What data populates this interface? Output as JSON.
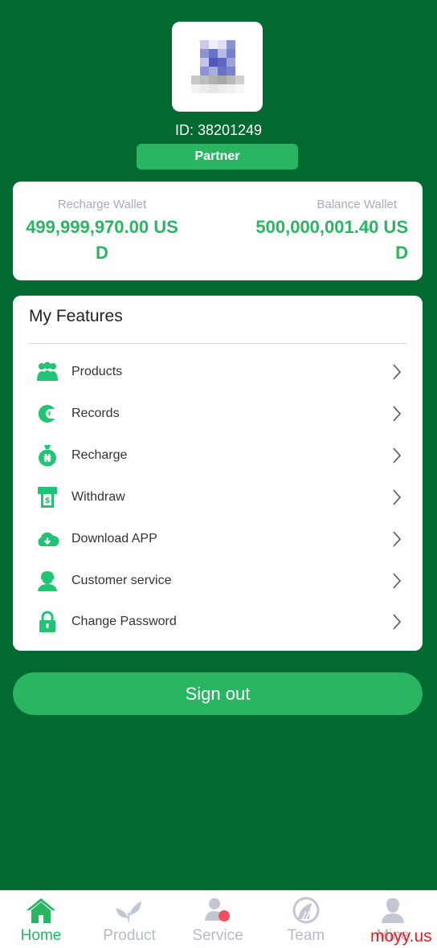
{
  "profile": {
    "id_text": "ID: 38201249",
    "badge": "Partner"
  },
  "wallets": {
    "recharge": {
      "label": "Recharge Wallet",
      "value": "499,999,970.00 USD"
    },
    "balance": {
      "label": "Balance Wallet",
      "value": "500,000,001.40 USD"
    }
  },
  "features": {
    "title": "My Features",
    "items": [
      {
        "label": "Products",
        "icon": "products-icon"
      },
      {
        "label": "Records",
        "icon": "records-icon"
      },
      {
        "label": "Recharge",
        "icon": "recharge-icon"
      },
      {
        "label": "Withdraw",
        "icon": "withdraw-icon"
      },
      {
        "label": "Download APP",
        "icon": "download-icon"
      },
      {
        "label": "Customer service",
        "icon": "customer-service-icon"
      },
      {
        "label": "Change Password",
        "icon": "lock-icon"
      }
    ]
  },
  "signout_label": "Sign out",
  "nav": {
    "items": [
      {
        "label": "Home",
        "icon": "home-icon",
        "active": true
      },
      {
        "label": "Product",
        "icon": "leaf-icon",
        "active": false
      },
      {
        "label": "Service",
        "icon": "service-icon",
        "active": false
      },
      {
        "label": "Team",
        "icon": "team-icon",
        "active": false
      },
      {
        "label": "Mine",
        "icon": "mine-icon",
        "active": false
      }
    ]
  },
  "watermark": "moyy.us",
  "colors": {
    "background": "#026a30",
    "accent": "#2ab562",
    "feature_icon": "#20c474",
    "muted": "#b5bac6"
  }
}
